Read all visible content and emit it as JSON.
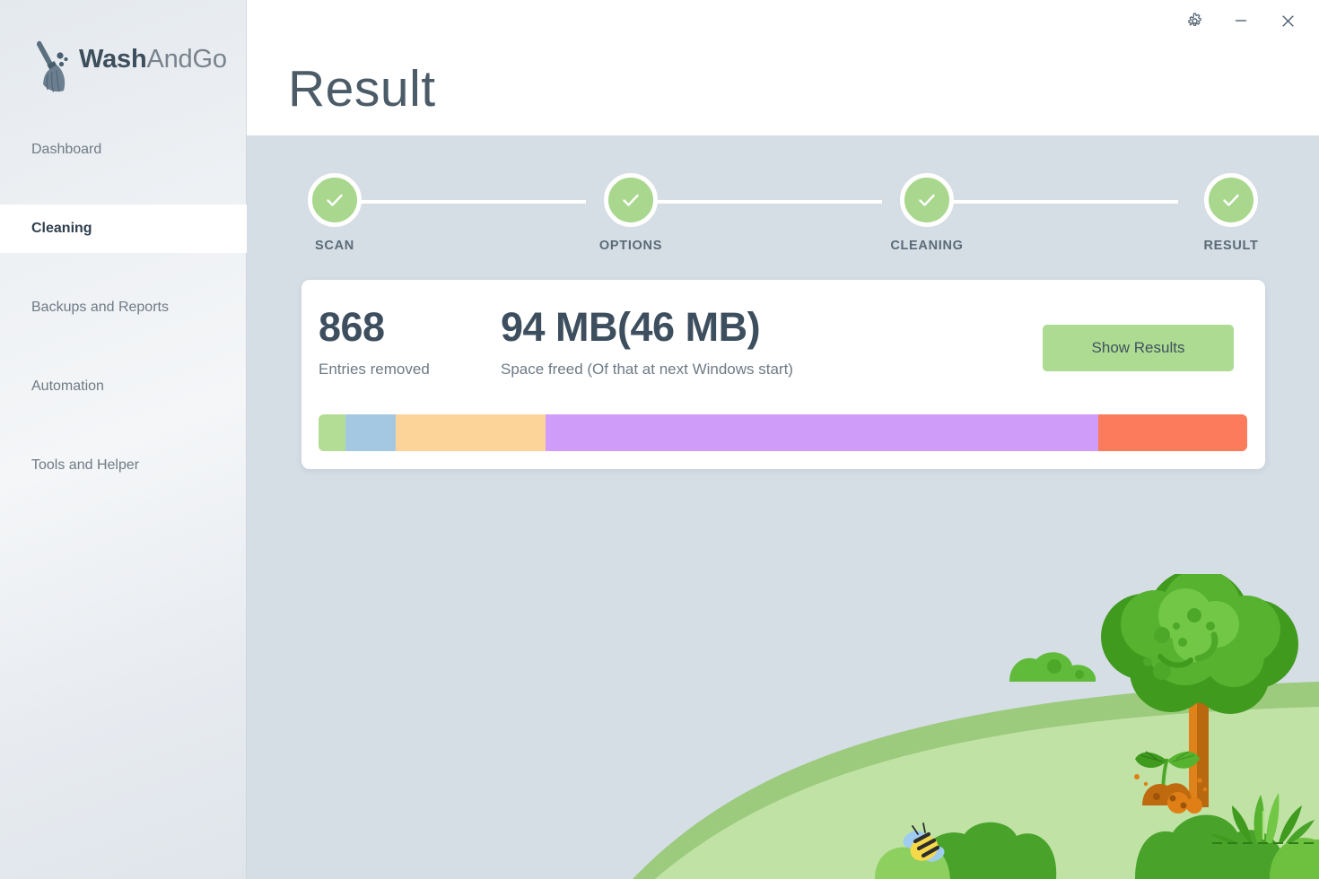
{
  "app": {
    "logo_bold": "Wash",
    "logo_light": "AndGo",
    "logo_icon": "broom-icon"
  },
  "titlebar": {
    "settings_icon": "gear-icon",
    "minimize_icon": "minimize-icon",
    "close_icon": "close-icon"
  },
  "header": {
    "title": "Result"
  },
  "sidebar": {
    "items": [
      {
        "label": "Dashboard",
        "active": false
      },
      {
        "label": "Cleaning",
        "active": true
      },
      {
        "label": "Backups and Reports",
        "active": false
      },
      {
        "label": "Automation",
        "active": false
      },
      {
        "label": "Tools and Helper",
        "active": false
      }
    ]
  },
  "steps": [
    {
      "label": "SCAN",
      "state": "complete",
      "icon": "check-icon"
    },
    {
      "label": "OPTIONS",
      "state": "complete",
      "icon": "check-icon"
    },
    {
      "label": "CLEANING",
      "state": "complete",
      "icon": "check-icon"
    },
    {
      "label": "RESULT",
      "state": "complete",
      "icon": "check-icon"
    }
  ],
  "result": {
    "entries_value": "868",
    "entries_label": "Entries removed",
    "space_value": "94 MB(46 MB)",
    "space_label": "Space freed (Of that at next Windows start)",
    "show_results_label": "Show Results"
  },
  "segments": [
    {
      "name": "segment-green",
      "color": "#b3dc95",
      "percent": 2.9
    },
    {
      "name": "segment-blue",
      "color": "#a4c8e2",
      "percent": 5.4
    },
    {
      "name": "segment-orange",
      "color": "#fcd49a",
      "percent": 16.1
    },
    {
      "name": "segment-purple",
      "color": "#cf9cf9",
      "percent": 59.6
    },
    {
      "name": "segment-red",
      "color": "#fb7b5c",
      "percent": 16.0
    }
  ],
  "colors": {
    "accent_green": "#addb91",
    "step_green": "#a9d78d",
    "content_bg": "#d5dde5",
    "sidebar_text": "#6f7b86",
    "title_text": "#4b5b68"
  },
  "illustration": {
    "parts": [
      "hill",
      "tree",
      "bush",
      "sprout",
      "grass",
      "bee"
    ]
  }
}
